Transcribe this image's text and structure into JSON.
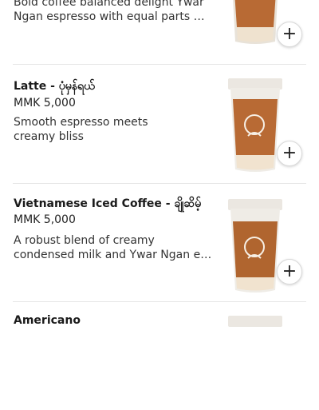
{
  "menu": {
    "items": [
      {
        "name": "",
        "price": "",
        "description_lines": [
          "Bold coffee balanced delight Ywar",
          "Ngan espresso with equal parts mi..."
        ],
        "add_icon": "plus-icon"
      },
      {
        "name": "Latte - ပုံမှန်ရယ်",
        "price": "MMK 5,000",
        "description_lines": [
          "Smooth espresso meets",
          "creamy bliss"
        ],
        "add_icon": "plus-icon"
      },
      {
        "name": "Vietnamese Iced Coffee - ချိုဆိမ့်",
        "price": "MMK 5,000",
        "description_lines": [
          "A robust blend of creamy",
          "condensed milk and Ywar Ngan es..."
        ],
        "add_icon": "plus-icon"
      },
      {
        "name": "Americano",
        "price": "",
        "description_lines": [],
        "add_icon": "plus-icon"
      }
    ]
  },
  "colors": {
    "coffee": "#b86a34",
    "milk": "#f1e3cf",
    "text": "#1b1b1b",
    "divider": "#e6e6e6"
  }
}
